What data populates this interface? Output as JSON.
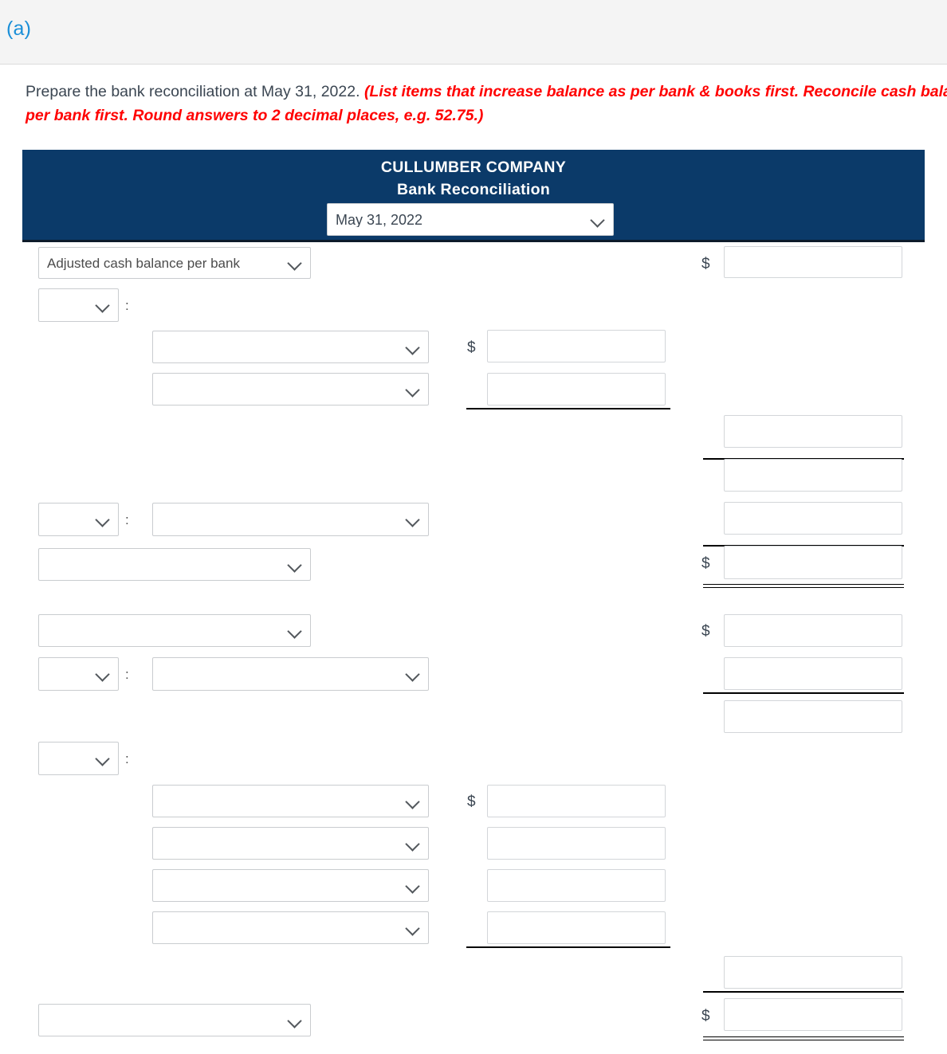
{
  "part": {
    "label": "(a)"
  },
  "instructions": {
    "line1_plain": "Prepare the bank reconciliation at May 31, 2022. ",
    "line1_hint": "(List items that increase balance as per bank & books first. Reconcile cash balance",
    "line2_hint": "per bank first. Round answers to 2 decimal places, e.g. 52.75.)"
  },
  "statement": {
    "company": "CULLUMBER COMPANY",
    "title": "Bank Reconciliation",
    "date_value": "May 31, 2022",
    "date_placeholder": "May 31, 2022"
  },
  "form": {
    "row1_label_value": "Adjusted cash balance per bank",
    "empty_value": "",
    "colon": ":",
    "currency_symbol": "$"
  },
  "colors": {
    "header_navy": "#0b3a69",
    "part_link_blue": "#1a8fd8",
    "hint_red": "#ff0000",
    "body_text": "#3b4652"
  }
}
